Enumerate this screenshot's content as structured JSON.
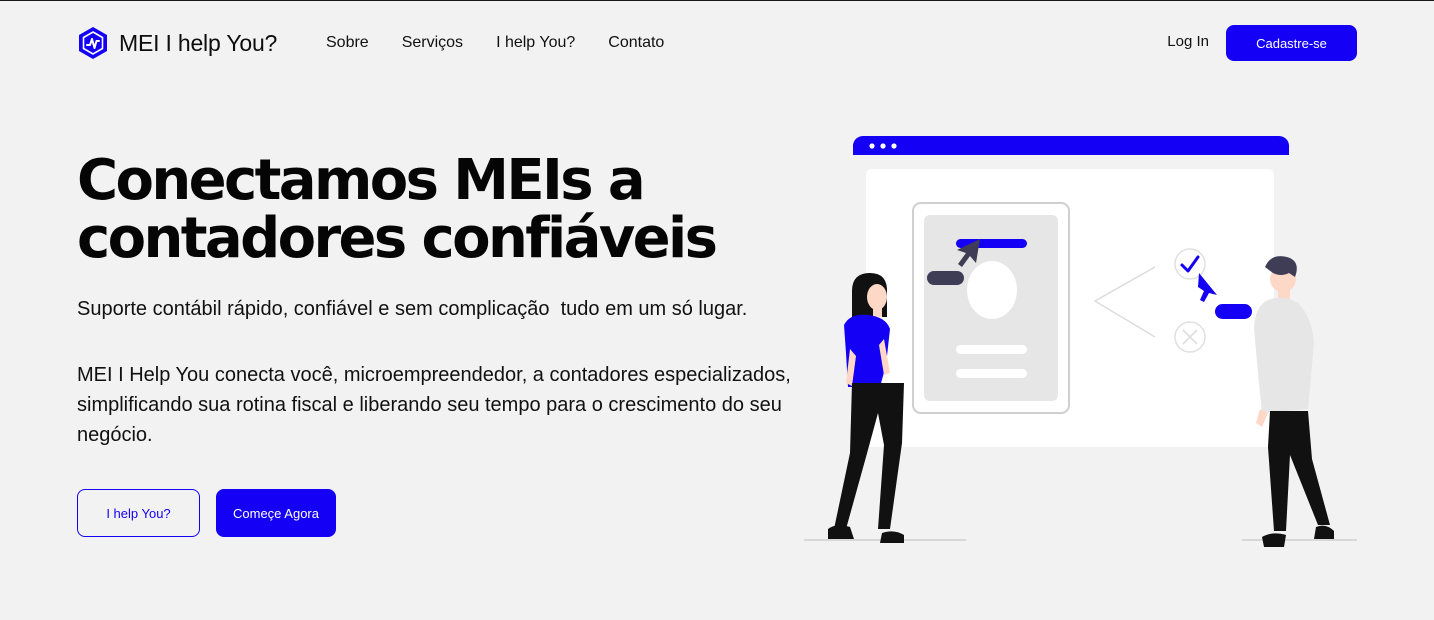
{
  "brand": {
    "name": "MEI I help You?",
    "accent": "#1400f5",
    "logo_icon": "hexagon-pulse-icon"
  },
  "nav": {
    "links": [
      "Sobre",
      "Serviços",
      "I help You?",
      "Contato"
    ],
    "login_label": "Log In",
    "signup_label": "Cadastre-se"
  },
  "hero": {
    "title_line1": "Conectamos MEIs a",
    "title_line2": "contadores confiáveis",
    "subtitle": "Suporte contábil rápido, confiável e sem complicação  tudo em um só lugar.",
    "description": "MEI I Help You conecta você, microempreendedor, a contadores especializados, simplificando sua rotina fiscal e liberando seu tempo para o crescimento do seu negócio.",
    "secondary_button": "I help You?",
    "primary_button": "Começe Agora"
  },
  "illustration": {
    "subject": "two-people-choosing-profile",
    "icons": [
      "check-icon",
      "close-icon",
      "cursor-icon"
    ]
  }
}
